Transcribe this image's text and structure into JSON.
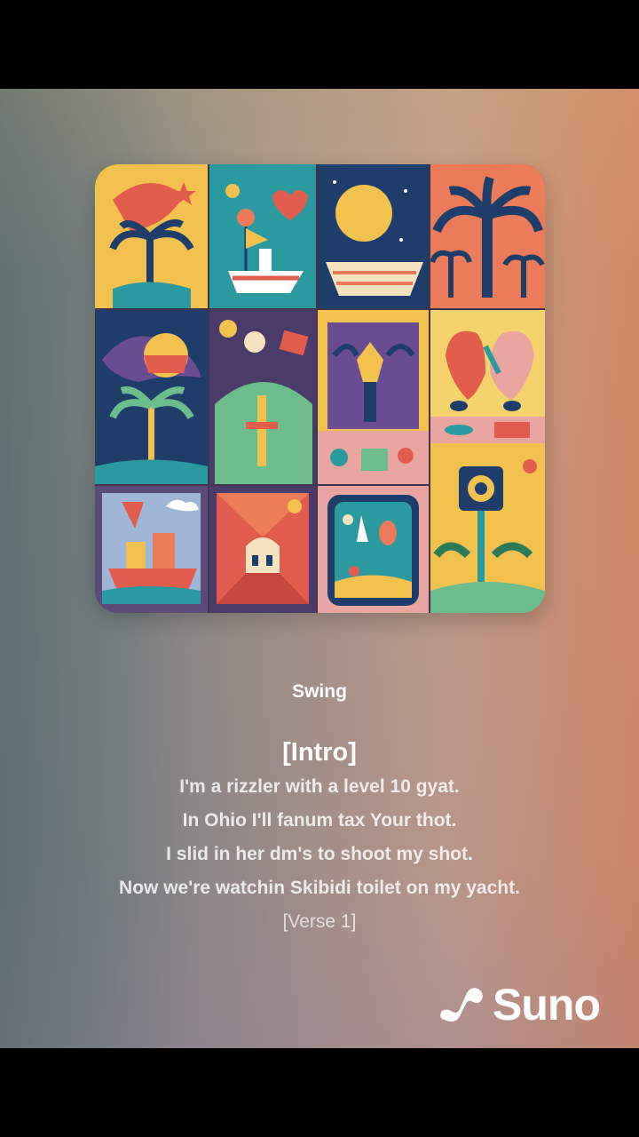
{
  "song": {
    "title": "Swing"
  },
  "lyrics": {
    "section": "[Intro]",
    "lines": [
      "I'm a rizzler with a level 10 gyat.",
      "In Ohio I'll fanum tax Your thot.",
      "I slid in her dm's to shoot my shot.",
      "Now we're watchin Skibidi toilet on my yacht.",
      "[Verse 1]"
    ]
  },
  "brand": {
    "name": "Suno",
    "icon": "suno-logo-icon"
  },
  "cover_art": {
    "icon": "album-cover-collage",
    "accent_colors": [
      "#f2c14e",
      "#2b9aa0",
      "#1e3d6b",
      "#ec7b5a",
      "#4a3b6b",
      "#e35d4f",
      "#6dbd8c"
    ]
  }
}
